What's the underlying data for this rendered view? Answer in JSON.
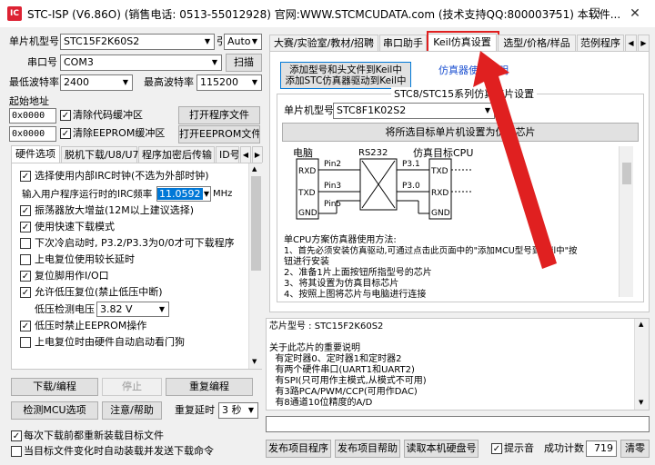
{
  "window": {
    "title": "STC-ISP (V6.86O) (销售电话: 0513-55012928) 官网:WWW.STCMCUDATA.com (技术支持QQ:800003751) 本软件...",
    "minimize": "—",
    "maximize": "☐",
    "close": "✕"
  },
  "left": {
    "mcu_type_label": "单片机型号",
    "mcu_type_value": "STC15F2K60S2",
    "pin_label": "引脚数",
    "pin_value": "Auto",
    "port_label": "串口号",
    "port_value": "COM3",
    "scan_button": "扫描",
    "min_baud_label": "最低波特率",
    "min_baud_value": "2400",
    "max_baud_label": "最高波特率",
    "max_baud_value": "115200",
    "start_addr_label": "起始地址",
    "addr1": "0x0000",
    "clear_code_label": "清除代码缓冲区",
    "open_program_button": "打开程序文件",
    "addr2": "0x0000",
    "clear_eeprom_label": "清除EEPROM缓冲区",
    "open_eeprom_button": "打开EEPROM文件",
    "tabs": [
      "硬件选项",
      "脱机下载/U8/U7",
      "程序加密后传输",
      "ID号"
    ],
    "options": [
      {
        "label": "选择使用内部IRC时钟(不选为外部时钟)",
        "checked": true
      },
      {
        "label": "输入用户程序运行时的IRC频率",
        "checked": null
      },
      {
        "label": "振荡器放大增益(12M以上建议选择)",
        "checked": true
      },
      {
        "label": "使用快速下载模式",
        "checked": true
      },
      {
        "label": "下次冷启动时, P3.2/P3.3为0/0才可下载程序",
        "checked": false
      },
      {
        "label": "上电复位使用较长延时",
        "checked": false
      },
      {
        "label": "复位脚用作I/O口",
        "checked": true
      },
      {
        "label": "允许低压复位(禁止低压中断)",
        "checked": true
      },
      {
        "label": "低压检测电压",
        "checked": null
      },
      {
        "label": "低压时禁止EEPROM操作",
        "checked": true
      },
      {
        "label": "上电复位时由硬件自动启动看门狗",
        "checked": false
      }
    ],
    "irc_freq_value": "11.0592",
    "irc_unit": "MHz",
    "low_voltage_value": "3.82 V",
    "download_button": "下载/编程",
    "stop_button": "停止",
    "reprogram_button": "重复编程",
    "detect_button": "检测MCU选项",
    "help_button": "注意/帮助",
    "repeat_delay_label": "重复延时",
    "repeat_delay_value": "3 秒",
    "reload_label": "每次下载前都重新装载目标文件",
    "auto_load_label": "当目标文件变化时自动装载并发送下载命令"
  },
  "right": {
    "tabs": [
      "大赛/实验室/教材/招聘",
      "串口助手",
      "Keil仿真设置",
      "选型/价格/样品",
      "范例程序"
    ],
    "tab_prev": "◀",
    "tab_next": "▶",
    "add_keil_line1": "添加型号和头文件到Keil中",
    "add_keil_line2": "添加STC仿真器驱动到Keil中",
    "emu_help_link": "仿真器使用说明",
    "group_title": "STC8/STC15系列仿真芯片设置",
    "mcu_type_label": "单片机型号",
    "mcu_type_value": "STC8F1K02S2",
    "set_emu_button": "将所选目标单片机设置为仿真芯片",
    "diagram": {
      "pc": "电脑",
      "rs232": "RS232",
      "target": "仿真目标CPU",
      "pins_left": [
        "RXD",
        "TXD",
        "GND"
      ],
      "pins_mid": [
        "Pin2",
        "Pin3",
        "Pin5"
      ],
      "pins_right_lbl": [
        "P3.1",
        "P3.0"
      ],
      "pins_right": [
        "TXD",
        "RXD",
        "GND"
      ]
    },
    "instructions": [
      "单CPU方案仿真器使用方法:",
      "1、首先必须安装仿真驱动,可通过点击此页面中的\"添加MCU型号到Keil中\"按",
      "钮进行安装",
      "2、准备1片上面按钮所指型号的芯片",
      "3、将其设置为仿真目标芯片",
      "4、按照上图将芯片与电脑进行连接"
    ],
    "chip_info": [
      "芯片型号 : STC15F2K60S2",
      "",
      "关于此芯片的重要说明",
      "  有定时器0、定时器1和定时器2",
      "  有两个硬件串口(UART1和UART2)",
      "  有SPI(只可用作主模式,从模式不可用)",
      "  有3路PCA/PWM/CCP(可用作DAC)",
      "  有8通道10位精度的A/D"
    ],
    "publish_program_button": "发布项目程序",
    "publish_help_button": "发布项目帮助",
    "read_disk_button": "读取本机硬盘号",
    "sound_label": "提示音",
    "success_count_label": "成功计数",
    "success_count_value": "719",
    "clear_button": "清零"
  },
  "colors": {
    "annotation_red": "#e02020",
    "selection_blue": "#0078d7",
    "link_blue": "#1a4fd0"
  }
}
